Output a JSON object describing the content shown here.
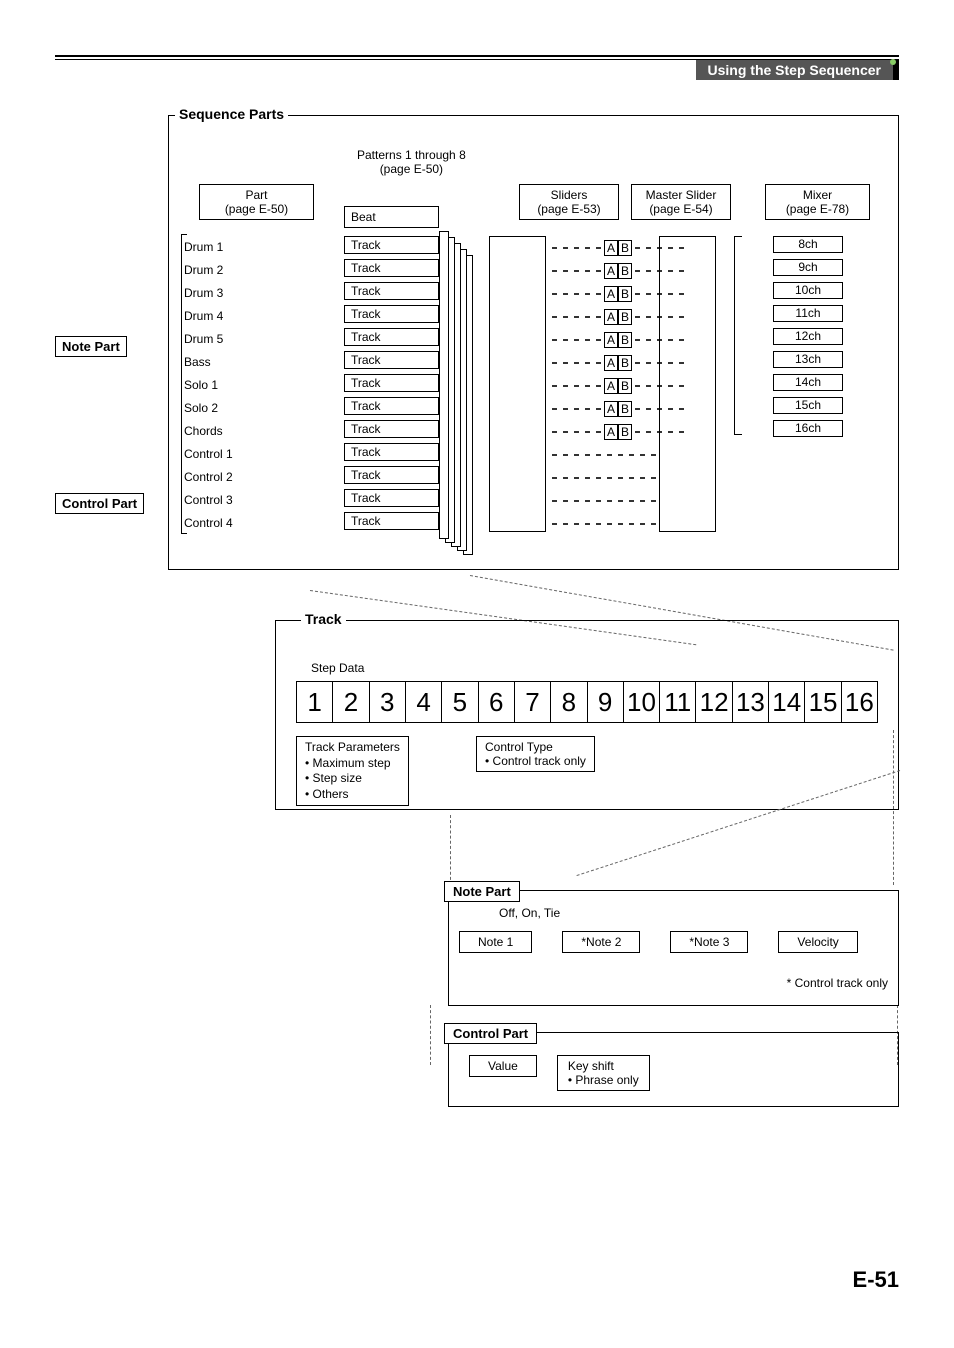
{
  "header": {
    "title": "Using the Step Sequencer"
  },
  "seq": {
    "title": "Sequence Parts",
    "patterns": {
      "line1": "Patterns 1 through 8",
      "line2": "(page E-50)"
    },
    "part": {
      "line1": "Part",
      "line2": "(page E-50)"
    },
    "beat": "Beat",
    "sliders": {
      "line1": "Sliders",
      "line2": "(page E-53)"
    },
    "master": {
      "line1": "Master Slider",
      "line2": "(page E-54)"
    },
    "mixer": {
      "line1": "Mixer",
      "line2": "(page E-78)"
    },
    "parts": [
      "Drum 1",
      "Drum 2",
      "Drum 3",
      "Drum 4",
      "Drum 5",
      "Bass",
      "Solo 1",
      "Solo 2",
      "Chords",
      "Control 1",
      "Control 2",
      "Control 3",
      "Control 4"
    ],
    "track_label": "Track",
    "ab": {
      "a": "A",
      "b": "B"
    },
    "mixer_ch": [
      "8ch",
      "9ch",
      "10ch",
      "11ch",
      "12ch",
      "13ch",
      "14ch",
      "15ch",
      "16ch"
    ]
  },
  "side": {
    "note_part": "Note Part",
    "control_part": "Control Part"
  },
  "track": {
    "title": "Track",
    "step_data": "Step Data",
    "steps": [
      "1",
      "2",
      "3",
      "4",
      "5",
      "6",
      "7",
      "8",
      "9",
      "10",
      "11",
      "12",
      "13",
      "14",
      "15",
      "16"
    ],
    "params": {
      "title": "Track Parameters",
      "b1": "• Maximum step",
      "b2": "• Step size",
      "b3": "• Others"
    },
    "ctrl_type": {
      "title": "Control Type",
      "b1": "• Control track only"
    }
  },
  "note_part": {
    "title": "Note Part",
    "off_on_tie": "Off, On, Tie",
    "boxes": [
      "Note 1",
      "*Note 2",
      "*Note 3",
      "Velocity"
    ],
    "footnote": "* Control track only"
  },
  "ctrl_part": {
    "title": "Control Part",
    "value": "Value",
    "keyshift": "Key shift",
    "phrase": "• Phrase only"
  },
  "page": "E-51"
}
